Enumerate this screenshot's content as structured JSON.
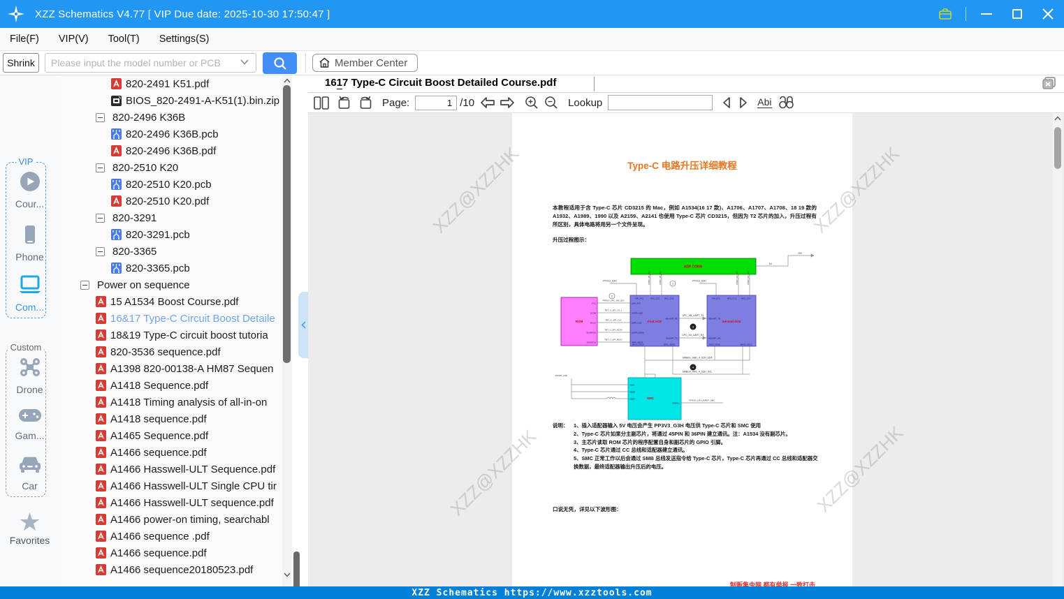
{
  "titlebar": {
    "title": "XZZ Schematics V4.77 [ VIP Due date: 2025-10-30 17:50:47 ]"
  },
  "menubar": {
    "items": [
      "File(F)",
      "VIP(V)",
      "Tool(T)",
      "Settings(S)"
    ]
  },
  "searchrow": {
    "shrink_label": "Shrink",
    "search_placeholder": "Please input the model number or PCB",
    "member_center_label": "Member Center"
  },
  "sidebar": {
    "vip_label": "VIP",
    "custom_label": "Custom",
    "favorites_label": "Favorites",
    "vip_items": [
      {
        "label": "Cour...",
        "icon": "play-course-icon",
        "active": false
      },
      {
        "label": "Phone",
        "icon": "phone-icon",
        "active": false
      },
      {
        "label": "Com...",
        "icon": "laptop-icon",
        "active": true
      }
    ],
    "custom_items": [
      {
        "label": "Drone",
        "icon": "drone-icon"
      },
      {
        "label": "Gam...",
        "icon": "gamepad-icon"
      },
      {
        "label": "Car",
        "icon": "car-icon"
      }
    ]
  },
  "tree": {
    "items": [
      {
        "type": "pdf",
        "level": 2,
        "label": "820-2491 K51.pdf"
      },
      {
        "type": "zip",
        "level": 2,
        "label": "BIOS_820-2491-A-K51(1).bin.zip"
      },
      {
        "type": "group",
        "level": 1,
        "label": "820-2496 K36B"
      },
      {
        "type": "pcb",
        "level": 2,
        "label": "820-2496 K36B.pcb"
      },
      {
        "type": "pdf",
        "level": 2,
        "label": "820-2496 K36B.pdf"
      },
      {
        "type": "group",
        "level": 1,
        "label": "820-2510 K20"
      },
      {
        "type": "pcb",
        "level": 2,
        "label": "820-2510 K20.pcb"
      },
      {
        "type": "pdf",
        "level": 2,
        "label": "820-2510 K20.pdf"
      },
      {
        "type": "group",
        "level": 1,
        "label": "820-3291"
      },
      {
        "type": "pcb",
        "level": 2,
        "label": "820-3291.pcb"
      },
      {
        "type": "group",
        "level": 1,
        "label": "820-3365"
      },
      {
        "type": "pcb",
        "level": 2,
        "label": "820-3365.pcb"
      },
      {
        "type": "group",
        "level": 0,
        "label": "Power on sequence"
      },
      {
        "type": "pdf",
        "level": 1,
        "label": "15 A1534 Boost Course.pdf"
      },
      {
        "type": "pdf",
        "level": 1,
        "label": "16&17 Type-C Circuit Boost Detaile",
        "selected": true
      },
      {
        "type": "pdf",
        "level": 1,
        "label": "18&19 Type-C circuit boost tutoria"
      },
      {
        "type": "pdf",
        "level": 1,
        "label": "820-3536 sequence.pdf"
      },
      {
        "type": "pdf",
        "level": 1,
        "label": "A1398 820-00138-A HM87 Sequen"
      },
      {
        "type": "pdf",
        "level": 1,
        "label": "A1418 Sequence.pdf"
      },
      {
        "type": "pdf",
        "level": 1,
        "label": "A1418 Timing analysis of all-in-on"
      },
      {
        "type": "pdf",
        "level": 1,
        "label": "A1418 sequence.pdf"
      },
      {
        "type": "pdf",
        "level": 1,
        "label": "A1465 Sequence.pdf"
      },
      {
        "type": "pdf",
        "level": 1,
        "label": "A1466  sequence.pdf"
      },
      {
        "type": "pdf",
        "level": 1,
        "label": "A1466 Hasswell-ULT Sequence.pdf"
      },
      {
        "type": "pdf",
        "level": 1,
        "label": "A1466 Hasswell-ULT Single CPU tir"
      },
      {
        "type": "pdf",
        "level": 1,
        "label": "A1466 Hasswell-ULT sequence.pdf"
      },
      {
        "type": "pdf",
        "level": 1,
        "label": "A1466 power-on timing, searchabl"
      },
      {
        "type": "pdf",
        "level": 1,
        "label": "A1466 sequence .pdf"
      },
      {
        "type": "pdf",
        "level": 1,
        "label": "A1466 sequence.pdf"
      },
      {
        "type": "pdf",
        "level": 1,
        "label": "A1466 sequence20180523.pdf"
      }
    ]
  },
  "viewer": {
    "tab_prefix": "16",
    "tab_underlined": "1",
    "tab_suffix": "7 Type-C Circuit Boost Detailed Course.pdf",
    "page_label": "Page:",
    "page_value": "1",
    "page_total": "/10",
    "lookup_label": "Lookup",
    "lookup_value": "",
    "abi_label": "Abi"
  },
  "document": {
    "watermark": "XZZ@XZZHK",
    "title": "Type-C 电路升压详细教程",
    "paragraph": "本教程适用于含 Type-C 芯片 CD3215 的 Mac，例如 A1534(16 17 款)、A1706、A1707、A1708、18 19 款的 A1932、A1989、1990 以及 A2159、A2141 也使用 Type-C 芯片 CD3215，但因为 T2 芯片的加入，升压过程有所区别，具体电路将用另一个文件呈现。",
    "subtitle": "升压过程图示：",
    "notes_label": "说明：",
    "notes": [
      "1、插入适配器输入 5V 电压会产生 PP3V3_G3H 电压供 Type-C 芯片和 SMC 使用",
      "2、Type-C 芯片如果分主副芯片，将通过 45PIN 和 36PIN 建立通讯。注：A1534 没有副芯片。",
      "3、主芯片读取 ROM 芯片的程序配置自身和副芯片的 GPIO 引脚。",
      "4、Type-C 芯片通过 CC 总线和适配器建立通讯。",
      "5、SMC 正常工作以后会通过 SMB 总线发送指令给 Type-C 芯片，Type-C 芯片再通过 CC 总线和适配器交换数据，最终适配器输出升压后的电压。"
    ],
    "closing": "口说无凭，详见以下波形图：",
    "footer_red": "制贩集虫网  都有举报  一致打击",
    "diagram": {
      "adp_conn": "ADP CONN",
      "rom": "ROM",
      "first_ace": "First ACE",
      "second_ace": "Second ACE",
      "smc": "SMC",
      "out_5v": "5V",
      "out_20v": "20V",
      "pp3v3_g3h_a": "PP3V3_G3H",
      "pp3v3_g3h_b": "PP3V3_G3H",
      "cc_b1": "USBC_XB_CC1",
      "cc_b2": "USBC_XB_CC2",
      "cc_a1": "USBC_XA_CC1",
      "cc_a2": "USBC_XA_CC2",
      "uart_tx": "UPC_XB_UART_TX",
      "uart_rx": "UPC_XA_UART_RX",
      "smbus_sda": "SMBUS_SMC_4_G3H_SDA",
      "smbus_scl": "SMBUS_SMC_4_G3H_SCL",
      "ldo": "PP3V3_UPC_XB_LDO",
      "spi_cs": "TBT_X_SPI_CS_L",
      "spi_clk": "TBT_X_SPI_CLK",
      "spi_mosi": "TBT_X_SPI_MOSI",
      "spi_miso": "TBT_X_SPI_MISO",
      "rom_vcc": "VCC",
      "rom_cs": "1/CS#",
      "rom_clk": "6/CLK",
      "rom_so": "SO(MOSI)",
      "rom_do": "2/DO(IO1)",
      "a1_vin": "VIN_3V3",
      "a1_cc1": "IN/C_CC1",
      "a1_cc2": "IN/C_CC2",
      "a1_ldo": "LDO_3V3",
      "a1_ssz": "14/SPI_SSZ",
      "a1_clk": "3/SPI_CLK",
      "a1_mosi": "15/SPI_MOSI",
      "a1_miso": "4/SPI_MISO",
      "a1_scl": "16/I2C_SCL2",
      "a1_sda": "5/I2C_SDA2",
      "a1_rx": "45/UART_RX",
      "a1_tx": "35/UART_TX",
      "a2_vin": "VIN_3V3",
      "a2_cc1": "IN/C_CC1",
      "a2_cc2": "IN/C_CC2",
      "a2_tx": "36/UART_TX",
      "a2_rx": "45/UART_RX",
      "a2_sda": "5/I2C_SDA2",
      "a2_scl": "16/I2C_SCL2",
      "smc_vbat": "VBAT",
      "smc_vddb": "VDDB",
      "smc_vdda": "VDDA",
      "smc_vref": "VREFA+",
      "smc_ref_sig": "PP3V0_G3H_AVREF_SMC",
      "smc_in": "PP3V0_G3H",
      "badge1": "1",
      "badge2": "2",
      "badge3": "3",
      "badge4": "4"
    }
  },
  "statusbar": {
    "text": "XZZ Schematics https://www.xzztools.com"
  }
}
